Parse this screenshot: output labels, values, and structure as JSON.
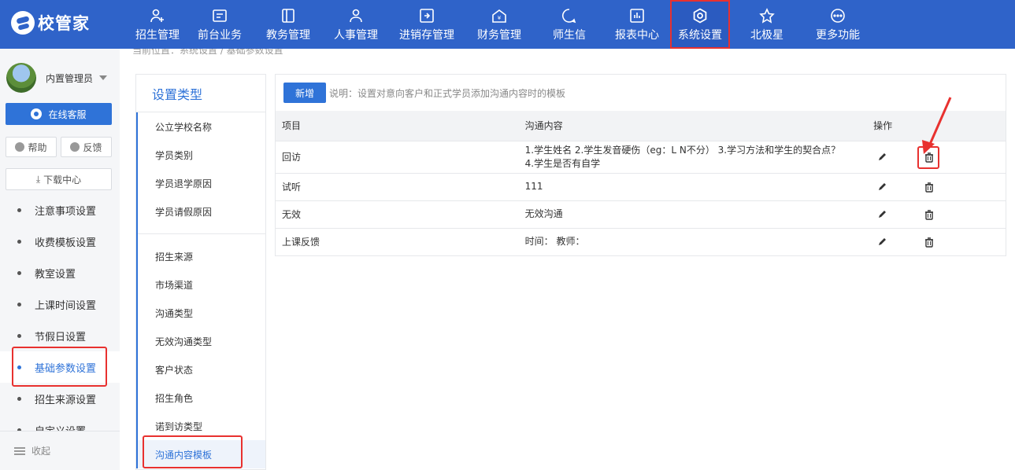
{
  "app": {
    "logo_text": "校管家",
    "brand_color": "#2f63c9",
    "accent_color": "#2f73d8",
    "highlight_color": "#e8312f"
  },
  "nav": {
    "items": [
      {
        "label": "招生管理",
        "icon": "person-add-icon"
      },
      {
        "label": "前台业务",
        "icon": "card-icon"
      },
      {
        "label": "教务管理",
        "icon": "book-icon"
      },
      {
        "label": "人事管理",
        "icon": "person-icon"
      },
      {
        "label": "进销存管理",
        "icon": "box-icon"
      },
      {
        "label": "财务管理",
        "icon": "yen-house-icon"
      },
      {
        "label": "师生信",
        "icon": "chat-icon"
      },
      {
        "label": "报表中心",
        "icon": "chart-icon"
      },
      {
        "label": "系统设置",
        "icon": "gear-icon",
        "active": true
      },
      {
        "label": "北极星",
        "icon": "star-icon"
      },
      {
        "label": "更多功能",
        "icon": "more-icon"
      }
    ]
  },
  "sidebar": {
    "user_name": "内置管理员",
    "online_service": "在线客服",
    "help": "帮助",
    "feedback": "反馈",
    "download": "下载中心",
    "menu": [
      {
        "label": "注意事项设置"
      },
      {
        "label": "收费模板设置"
      },
      {
        "label": "教室设置"
      },
      {
        "label": "上课时间设置"
      },
      {
        "label": "节假日设置"
      },
      {
        "label": "基础参数设置",
        "active": true
      },
      {
        "label": "招生来源设置"
      },
      {
        "label": "自定义设置"
      }
    ],
    "collapse": "收起"
  },
  "breadcrumb": "当前位置：系统设置 / 基础参数设置",
  "type_panel": {
    "title": "设置类型",
    "group1": [
      "公立学校名称",
      "学员类别",
      "学员退学原因",
      "学员请假原因"
    ],
    "group2": [
      "招生来源",
      "市场渠道",
      "沟通类型",
      "无效沟通类型",
      "客户状态",
      "招生角色",
      "诺到访类型",
      "沟通内容模板"
    ],
    "active": "沟通内容模板"
  },
  "main": {
    "add_button": "新增",
    "note": "说明：设置对意向客户和正式学员添加沟通内容时的模板",
    "columns": {
      "item": "项目",
      "content": "沟通内容",
      "action": "操作"
    },
    "rows": [
      {
        "item": "回访",
        "content_line1": "1.学生姓名 2.学生发音硬伤（eg：L N不分） 3.学习方法和学生的契合点？",
        "content_line2": "4.学生是否有自学"
      },
      {
        "item": "试听",
        "content_line1": "111",
        "content_line2": ""
      },
      {
        "item": "无效",
        "content_line1": "无效沟通",
        "content_line2": ""
      },
      {
        "item": "上课反馈",
        "content_line1": "时间： 教师：",
        "content_line2": ""
      }
    ]
  }
}
